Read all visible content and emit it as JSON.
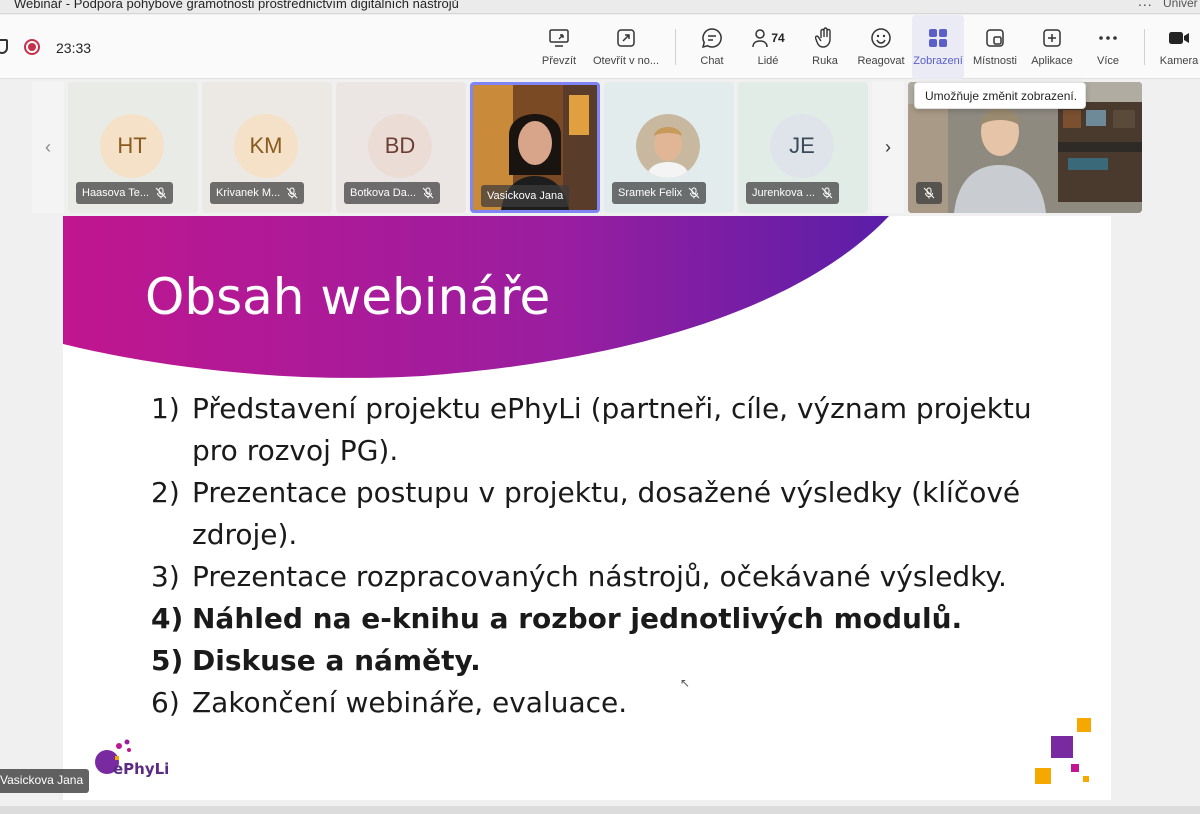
{
  "window": {
    "title": "Webinář - Podpora pohybové gramotnosti prostřednictvím digitálních nástrojů",
    "more_label": "...",
    "org_label": "Univer"
  },
  "call": {
    "timer": "23:33"
  },
  "toolbar": {
    "buttons": [
      {
        "label": "Převzít",
        "icon": "share-screen-icon"
      },
      {
        "label": "Otevřít v no...",
        "icon": "open-window-icon"
      },
      {
        "label": "Chat",
        "icon": "chat-icon"
      },
      {
        "label": "Lidé",
        "icon": "people-icon",
        "count": "74"
      },
      {
        "label": "Ruka",
        "icon": "raise-hand-icon"
      },
      {
        "label": "Reagovat",
        "icon": "react-icon"
      },
      {
        "label": "Zobrazení",
        "icon": "view-icon",
        "active": true
      },
      {
        "label": "Místnosti",
        "icon": "rooms-icon"
      },
      {
        "label": "Aplikace",
        "icon": "apps-icon"
      },
      {
        "label": "Více",
        "icon": "more-icon"
      },
      {
        "label": "Kamera",
        "icon": "camera-icon"
      }
    ],
    "tooltip": "Umožňuje změnit zobrazení."
  },
  "gallery": {
    "participants": [
      {
        "initials": "HT",
        "name": "Haasova Te...",
        "avatar_bg": "#f5e1c8",
        "avatar_fg": "#8a5a1e"
      },
      {
        "initials": "KM",
        "name": "Krivanek M...",
        "avatar_bg": "#f5e1c8",
        "avatar_fg": "#8a5a1e"
      },
      {
        "initials": "BD",
        "name": "Botkova Da...",
        "avatar_bg": "#ecdcd6",
        "avatar_fg": "#6b3f33"
      },
      {
        "initials": "",
        "name": "Vasickova Jana",
        "video": true
      },
      {
        "initials": "",
        "name": "Sramek Felix",
        "photo": true
      },
      {
        "initials": "JE",
        "name": "Jurenkova ...",
        "avatar_bg": "#dfe4ea",
        "avatar_fg": "#3a4a5a"
      }
    ]
  },
  "slide": {
    "title": "Obsah webináře",
    "items": [
      {
        "num": "1)",
        "text": "Představení projektu ePhyLi (partneři, cíle, význam projektu pro rozvoj PG).",
        "bold": false
      },
      {
        "num": "2)",
        "text": "Prezentace postupu v projektu, dosažené výsledky (klíčové zdroje).",
        "bold": false
      },
      {
        "num": "3)",
        "text": "Prezentace rozpracovaných nástrojů, očekávané výsledky.",
        "bold": false
      },
      {
        "num": "4)",
        "text": "Náhled na e-knihu a rozbor jednotlivých modulů.",
        "bold": true
      },
      {
        "num": "5)",
        "text": "Diskuse a náměty.",
        "bold": true
      },
      {
        "num": "6)",
        "text": "Zakončení webináře, evaluace.",
        "bold": false
      }
    ],
    "logo_text": "ePhyLi"
  },
  "presenter_label": "Vasickova Jana",
  "colors": {
    "accent": "#5b5fc7",
    "slide_magenta": "#c0168f",
    "slide_purple": "#6a1fa0",
    "deco_orange": "#f7a800"
  }
}
